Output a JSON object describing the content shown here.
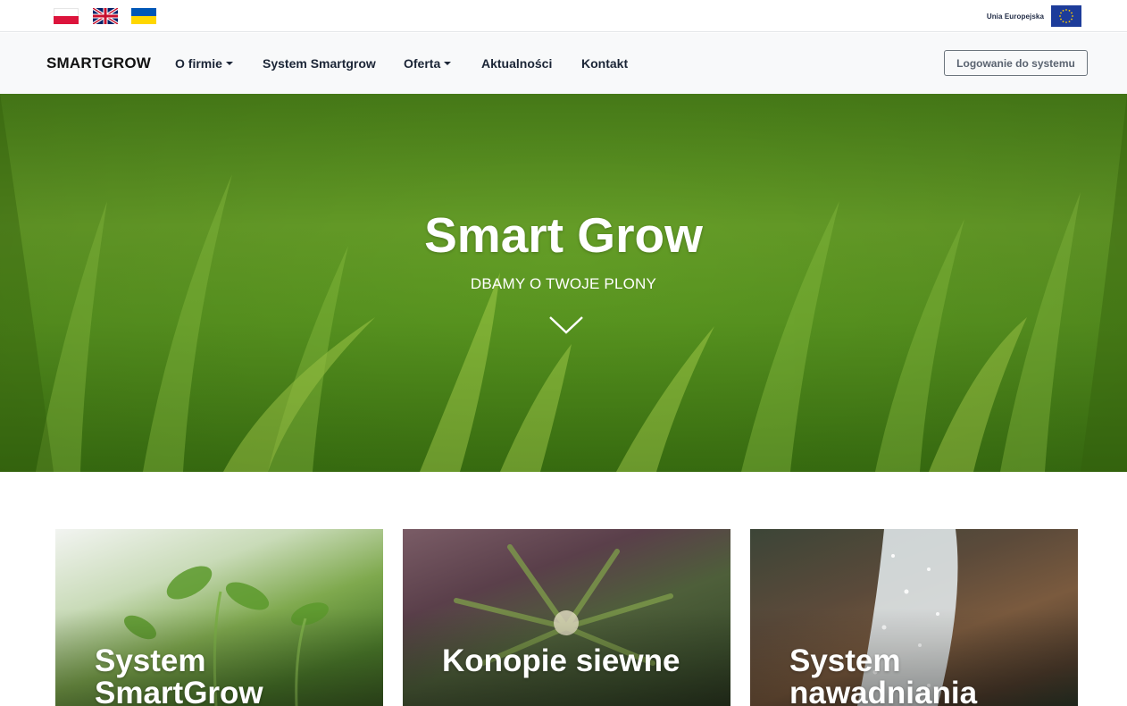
{
  "languages": [
    {
      "code": "pl",
      "icon": "poland-flag-icon"
    },
    {
      "code": "en",
      "icon": "uk-flag-icon"
    },
    {
      "code": "ua",
      "icon": "ukraine-flag-icon"
    }
  ],
  "eu": {
    "label": "Unia Europejska",
    "icon": "eu-flag-icon"
  },
  "navbar": {
    "brand": "SMARTGROW",
    "items": [
      {
        "label": "O firmie",
        "dropdown": true
      },
      {
        "label": "System Smartgrow",
        "dropdown": false
      },
      {
        "label": "Oferta",
        "dropdown": true
      },
      {
        "label": "Aktualności",
        "dropdown": false
      },
      {
        "label": "Kontakt",
        "dropdown": false
      }
    ],
    "login_label": "Logowanie do systemu"
  },
  "hero": {
    "title": "Smart Grow",
    "subtitle": "DBAMY O TWOJE PLONY",
    "arrow_icon": "chevron-down-icon"
  },
  "cards": [
    {
      "line1": "System",
      "line2": "SmartGrow"
    },
    {
      "line1": "Konopie siewne",
      "line2": ""
    },
    {
      "line1": "System",
      "line2": "nawadniania"
    }
  ],
  "colors": {
    "navbar_bg": "#f8f9fa",
    "nav_text": "#1b2536",
    "hero_green": "#6ca82a",
    "login_border": "#6c757d"
  }
}
